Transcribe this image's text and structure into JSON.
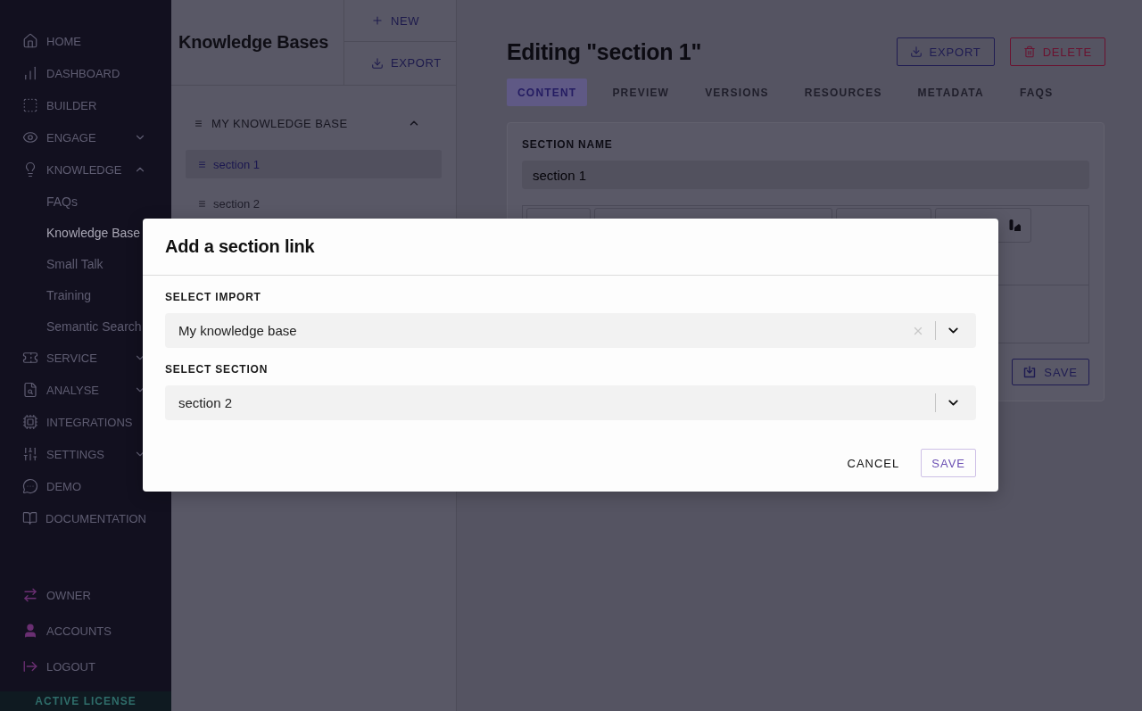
{
  "sidebar": {
    "items": [
      {
        "label": "HOME",
        "selected": false
      },
      {
        "label": "DASHBOARD",
        "selected": false
      },
      {
        "label": "BUILDER",
        "selected": false
      },
      {
        "label": "ENGAGE",
        "selected": false,
        "expanded": false
      },
      {
        "label": "KNOWLEDGE",
        "selected": false,
        "expanded": true,
        "children": [
          {
            "label": "FAQs",
            "selected": false
          },
          {
            "label": "Knowledge Base",
            "selected": true
          },
          {
            "label": "Small Talk",
            "selected": false
          },
          {
            "label": "Training",
            "selected": false
          },
          {
            "label": "Semantic Search",
            "selected": false
          }
        ]
      },
      {
        "label": "SERVICE",
        "selected": false,
        "expanded": false
      },
      {
        "label": "ANALYSE",
        "selected": false,
        "expanded": false
      },
      {
        "label": "INTEGRATIONS",
        "selected": false
      },
      {
        "label": "SETTINGS",
        "selected": false,
        "expanded": false
      },
      {
        "label": "DEMO",
        "selected": false
      },
      {
        "label": "DOCUMENTATION",
        "selected": false
      }
    ],
    "account_items": [
      {
        "label": "OWNER"
      },
      {
        "label": "ACCOUNTS"
      },
      {
        "label": "LOGOUT"
      }
    ],
    "license": "ACTIVE LICENSE"
  },
  "knowledge_bases": {
    "title": "Knowledge Bases",
    "actions": [
      {
        "kind": "new",
        "label": "NEW"
      },
      {
        "kind": "export",
        "label": "EXPORT"
      }
    ],
    "tree": [
      {
        "label": "MY KNOWLEDGE BASE",
        "expanded": true,
        "children": [
          {
            "label": "section 1",
            "selected": true
          },
          {
            "label": "section 2",
            "selected": false
          }
        ]
      }
    ]
  },
  "editor": {
    "title": "Editing \"section 1\"",
    "actions": [
      {
        "kind": "export",
        "label": "EXPORT"
      },
      {
        "kind": "delete",
        "label": "DELETE"
      }
    ],
    "tabs": [
      {
        "label": "CONTENT",
        "selected": true
      },
      {
        "label": "PREVIEW",
        "selected": false
      },
      {
        "label": "VERSIONS",
        "selected": false
      },
      {
        "label": "RESOURCES",
        "selected": false
      },
      {
        "label": "METADATA",
        "selected": false
      },
      {
        "label": "FAQS",
        "selected": false
      }
    ],
    "section_name": {
      "label": "SECTION NAME",
      "value": "section 1"
    },
    "save_button": "SAVE"
  },
  "modal": {
    "title": "Add a section link",
    "fields": [
      {
        "label": "SELECT IMPORT",
        "value": "My knowledge base",
        "clearable": true
      },
      {
        "label": "SELECT SECTION",
        "value": "section 2",
        "clearable": false
      }
    ],
    "buttons": [
      {
        "kind": "text",
        "label": "CANCEL"
      },
      {
        "kind": "outlined",
        "label": "SAVE"
      }
    ]
  }
}
